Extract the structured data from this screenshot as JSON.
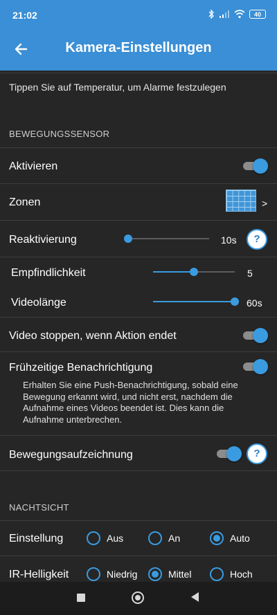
{
  "status_bar": {
    "time": "21:02",
    "battery": "40",
    "icons": [
      "bluetooth-icon",
      "signal-icon",
      "wifi-icon",
      "battery-icon"
    ]
  },
  "app_bar": {
    "title": "Kamera-Einstellungen",
    "back_icon": "arrow-left-icon"
  },
  "hint": "Tippen Sie auf Temperatur, um Alarme festzulegen",
  "motion": {
    "section_title": "BEWEGUNGSSENSOR",
    "activate_label": "Aktivieren",
    "activate_on": true,
    "zones_label": "Zonen",
    "zones_chevron": ">",
    "reactivation_label": "Reaktivierung",
    "reactivation_value": "10s",
    "reactivation_fraction": 0.0,
    "help": "?",
    "sensitivity_label": "Empfindlichkeit",
    "sensitivity_value": "5",
    "sensitivity_fraction": 0.5,
    "video_length_label": "Videolänge",
    "video_length_value": "60s",
    "video_length_fraction": 1.0,
    "stop_video_label": "Video stoppen, wenn Aktion endet",
    "stop_video_on": true,
    "early_notify_label": "Frühzeitige Benachrichtigung",
    "early_notify_on": true,
    "early_notify_desc": "Erhalten Sie eine Push-Benachrichtigung, sobald eine Bewegung erkannt wird, und nicht erst, nachdem die Aufnahme eines Videos beendet ist. Dies kann die Aufnahme unterbrechen.",
    "motion_recording_label": "Bewegungsaufzeichnung",
    "motion_recording_on": true
  },
  "night_vision": {
    "section_title": "NACHTSICHT",
    "setting_label": "Einstellung",
    "setting_options": [
      "Aus",
      "An",
      "Auto"
    ],
    "setting_selected": "Auto",
    "ir_label": "IR-Helligkeit",
    "ir_options": [
      "Niedrig",
      "Mittel",
      "Hoch"
    ],
    "ir_selected": "Mittel"
  },
  "colors": {
    "accent": "#3a9be0",
    "bar": "#3a8fd6",
    "background": "#262626"
  }
}
